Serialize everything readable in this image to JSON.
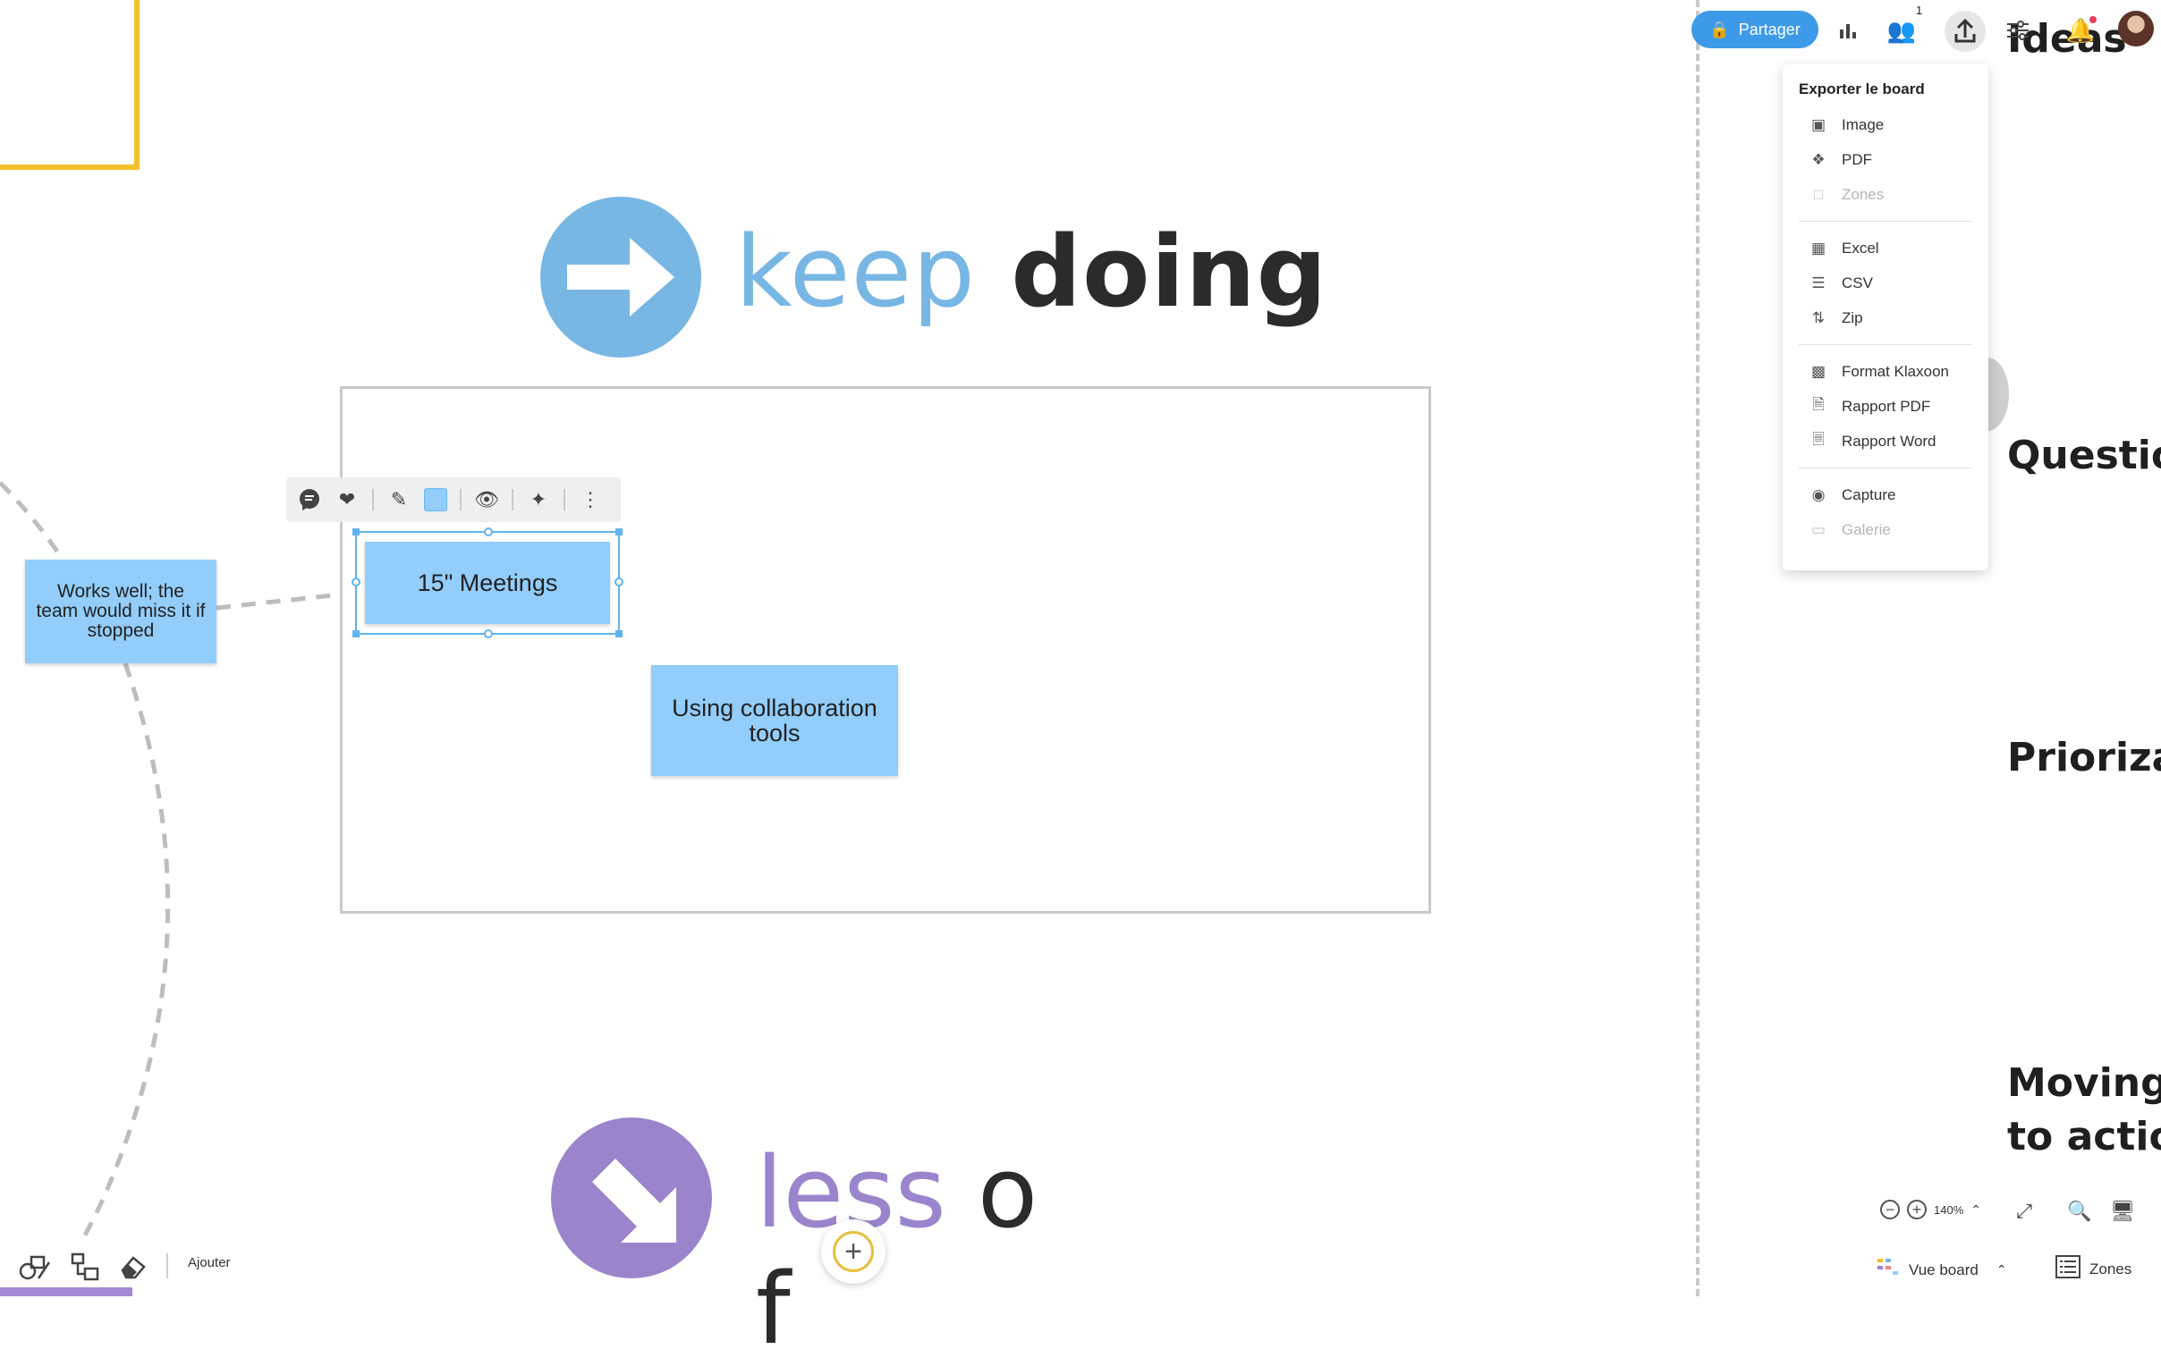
{
  "canvas": {
    "keep": {
      "word1": "keep",
      "word2": "doing",
      "color": "#78b7e4"
    },
    "less": {
      "word1": "less",
      "word2": "o",
      "line2": "f"
    },
    "notes": [
      {
        "text": "Works well; the team would miss it if stopped"
      },
      {
        "text": "15\" Meetings"
      },
      {
        "text": "Using collaboration tools"
      }
    ],
    "note_color": "#92cdfb"
  },
  "note_toolbar": {
    "icons": [
      "comment-icon",
      "heart-icon",
      "pencil-icon",
      "color-swatch",
      "eye-icon",
      "sparkle-icon",
      "more-icon"
    ]
  },
  "topbar": {
    "share_label": "Partager",
    "participants_count": "1",
    "accent": "#3d9ae8"
  },
  "export_menu": {
    "title": "Exporter le board",
    "groups": [
      [
        {
          "label": "Image",
          "icon": "image-icon",
          "disabled": false
        },
        {
          "label": "PDF",
          "icon": "pdf-icon",
          "disabled": false
        },
        {
          "label": "Zones",
          "icon": "zones-icon",
          "disabled": true
        }
      ],
      [
        {
          "label": "Excel",
          "icon": "excel-icon",
          "disabled": false
        },
        {
          "label": "CSV",
          "icon": "csv-icon",
          "disabled": false
        },
        {
          "label": "Zip",
          "icon": "zip-icon",
          "disabled": false
        }
      ],
      [
        {
          "label": "Format Klaxoon",
          "icon": "klaxoon-icon",
          "disabled": false
        },
        {
          "label": "Rapport PDF",
          "icon": "report-pdf-icon",
          "disabled": false
        },
        {
          "label": "Rapport Word",
          "icon": "report-word-icon",
          "disabled": false
        }
      ],
      [
        {
          "label": "Capture",
          "icon": "capture-icon",
          "disabled": false
        },
        {
          "label": "Galerie",
          "icon": "gallery-icon",
          "disabled": true
        }
      ]
    ]
  },
  "right_column": {
    "titles": [
      "Ideas",
      "Questio",
      "Prioriza",
      "Moving",
      "to actio"
    ]
  },
  "bottom_left": {
    "add_label": "Ajouter"
  },
  "bottom_right": {
    "zoom": "140%",
    "view_label": "Vue board",
    "zones_label": "Zones"
  }
}
